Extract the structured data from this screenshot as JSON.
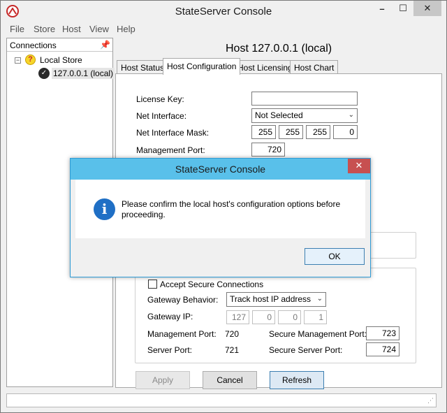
{
  "window": {
    "title": "StateServer Console",
    "minimize": "–",
    "maximize": "☐",
    "close": "✕"
  },
  "menu": [
    "File",
    "Store",
    "Host",
    "View",
    "Help"
  ],
  "connections": {
    "title": "Connections",
    "root_toggle": "−",
    "root_label": "Local Store",
    "host_label": "127.0.0.1 (local)"
  },
  "host_title": "Host 127.0.0.1 (local)",
  "tabs": [
    "Host Status",
    "Host Configuration",
    "Host Licensing",
    "Host Chart"
  ],
  "config": {
    "license_key_label": "License Key:",
    "license_key_value": "",
    "net_interface_label": "Net Interface:",
    "net_interface_value": "Not Selected",
    "net_mask_label": "Net Interface Mask:",
    "net_mask": [
      "255",
      "255",
      "255",
      "0"
    ],
    "mgmt_port_label": "Management Port:",
    "mgmt_port_value": "720",
    "accept_secure_label": "Accept Secure Connections",
    "accept_secure_checked": false,
    "gateway_behavior_label": "Gateway Behavior:",
    "gateway_behavior_value": "Track host IP address",
    "gateway_ip_label": "Gateway IP:",
    "gateway_ip": [
      "127",
      "0",
      "0",
      "1"
    ],
    "gw_mgmt_port_label": "Management Port:",
    "gw_mgmt_port_value": "720",
    "secure_mgmt_port_label": "Secure Management Port:",
    "secure_mgmt_port_value": "723",
    "server_port_label": "Server Port:",
    "server_port_value": "721",
    "secure_server_port_label": "Secure Server Port:",
    "secure_server_port_value": "724"
  },
  "buttons": {
    "apply": "Apply",
    "cancel": "Cancel",
    "refresh": "Refresh"
  },
  "dialog": {
    "title": "StateServer Console",
    "close": "✕",
    "icon": "i",
    "message": "Please confirm the local host's configuration options before proceeding.",
    "ok": "OK"
  },
  "colors": {
    "dialog_title": "#59c0ea",
    "close_red": "#c75050",
    "info_blue": "#1f6fc5"
  }
}
